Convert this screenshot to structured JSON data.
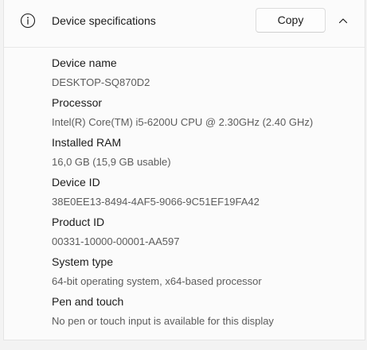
{
  "header": {
    "title": "Device specifications",
    "copy_label": "Copy",
    "info_icon": "info-icon",
    "collapse_icon": "chevron-up-icon"
  },
  "specs": [
    {
      "label": "Device name",
      "value": "DESKTOP-SQ870D2"
    },
    {
      "label": "Processor",
      "value": "Intel(R) Core(TM) i5-6200U CPU @ 2.30GHz (2.40 GHz)"
    },
    {
      "label": "Installed RAM",
      "value": "16,0 GB (15,9 GB usable)"
    },
    {
      "label": "Device ID",
      "value": "38E0EE13-8494-4AF5-9066-9C51EF19FA42"
    },
    {
      "label": "Product ID",
      "value": "00331-10000-00001-AA597"
    },
    {
      "label": "System type",
      "value": "64-bit operating system, x64-based processor"
    },
    {
      "label": "Pen and touch",
      "value": "No pen or touch input is available for this display"
    }
  ]
}
